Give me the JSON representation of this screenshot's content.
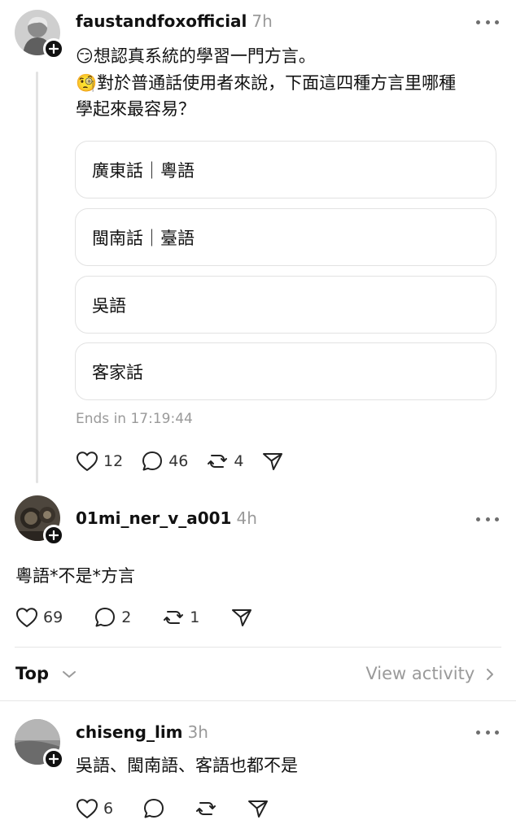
{
  "post": {
    "username": "faustandfoxofficial",
    "time": "7h",
    "line1_emoji": "😏",
    "line1": "想認真系統的學習一門方言。",
    "line2_emoji": "🧐",
    "line2": "對於普通話使用者來說，下面這四種方言里哪種",
    "line3": "學起來最容易？",
    "poll_options": [
      "廣東話｜粵語",
      "閩南話｜臺語",
      "吳語",
      "客家話"
    ],
    "ends": "Ends in 17:19:44",
    "likes": "12",
    "comments": "46",
    "reposts": "4"
  },
  "reply1": {
    "username": "01mi_ner_v_a001",
    "time": "4h",
    "text": "粵語*不是*方言",
    "likes": "69",
    "comments": "2",
    "reposts": "1"
  },
  "sort": {
    "label": "Top",
    "view_activity": "View activity"
  },
  "reply2": {
    "username": "chiseng_lim",
    "time": "3h",
    "text": "吳語、閩南語、客語也都不是",
    "likes": "6"
  },
  "icons": {
    "heart": "heart-icon",
    "comment": "comment-icon",
    "repost": "repost-icon",
    "share": "send-icon",
    "more": "more-icon",
    "chevron_down": "chevron-down-icon",
    "chevron_right": "chevron-right-icon",
    "follow": "plus-icon"
  }
}
